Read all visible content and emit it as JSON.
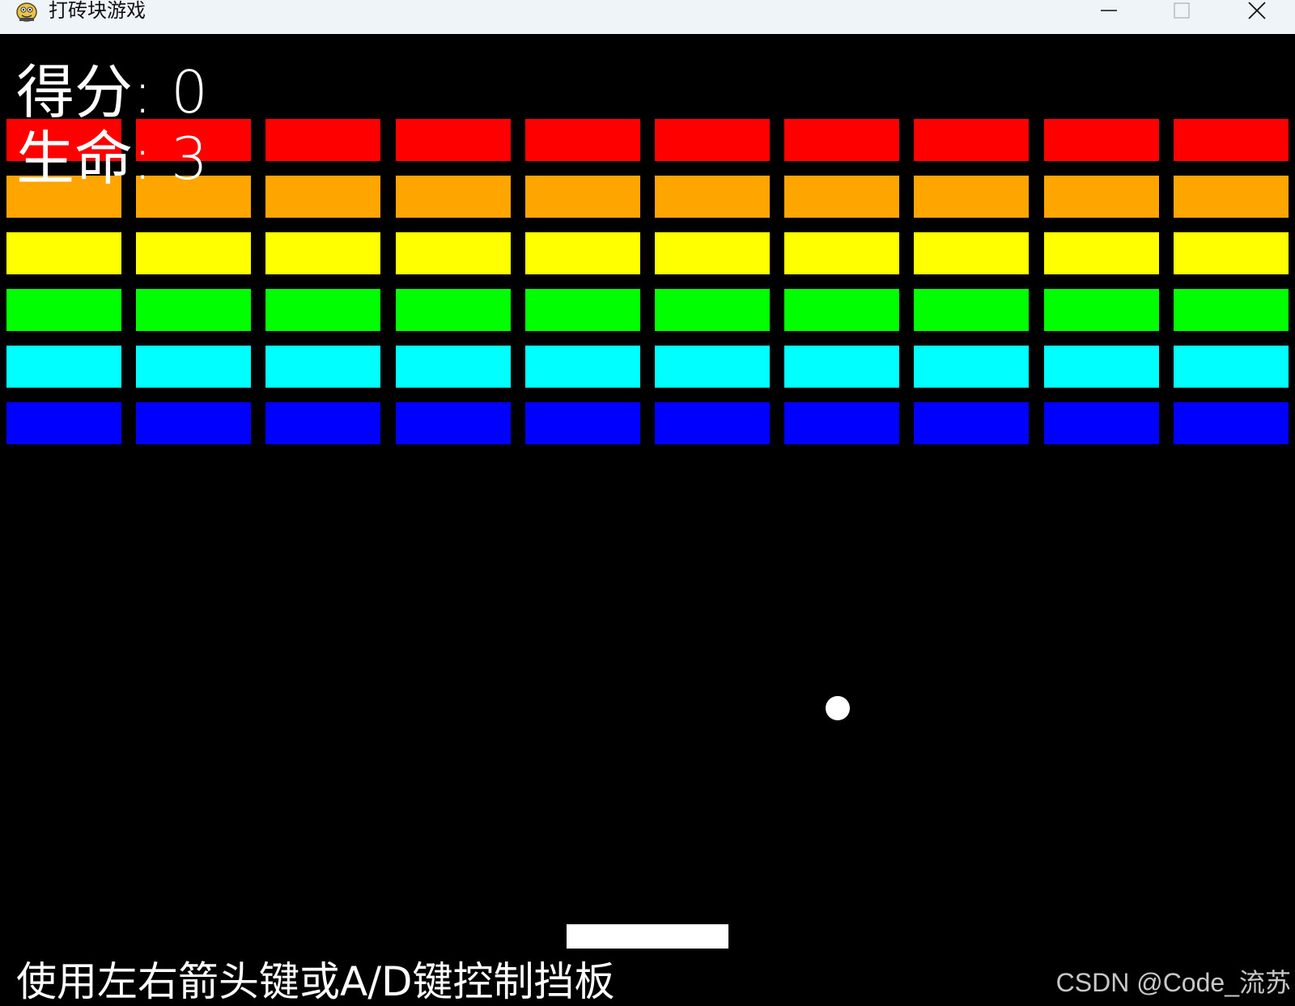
{
  "window": {
    "title": "打砖块游戏",
    "controls": {
      "minimize_icon": "minimize-icon",
      "maximize_icon": "maximize-icon",
      "close_icon": "close-icon"
    }
  },
  "hud": {
    "score_text": "得分: 0",
    "lives_text": "生命: 3"
  },
  "bricks": {
    "columns": 10,
    "row_colors": [
      "#ff0000",
      "#ffa500",
      "#ffff00",
      "#00ff00",
      "#00ffff",
      "#0000ff"
    ]
  },
  "instructions": "使用左右箭头键或A/D键控制挡板",
  "watermark": "CSDN @Code_流苏",
  "colors": {
    "background": "#000000",
    "ball": "#ffffff",
    "paddle": "#ffffff",
    "text": "#ffffff"
  }
}
